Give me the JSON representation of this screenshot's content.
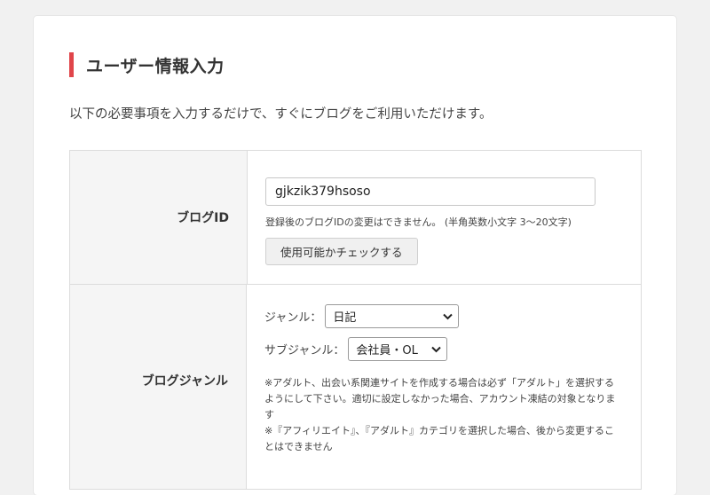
{
  "section": {
    "title": "ユーザー情報入力"
  },
  "intro": "以下の必要事項を入力するだけで、すぐにブログをご利用いただけます。",
  "blog_id": {
    "label": "ブログID",
    "value": "gjkzik379hsoso",
    "note": "登録後のブログIDの変更はできません。 (半角英数小文字 3〜20文字)",
    "check_button": "使用可能かチェックする"
  },
  "genre": {
    "label": "ブログジャンル",
    "genre_label": "ジャンル：",
    "genre_value": "日記",
    "subgenre_label": "サブジャンル：",
    "subgenre_value": "会社員・OL",
    "warning_1": "※アダルト、出会い系関連サイトを作成する場合は必ず「アダルト」を選択するようにして下さい。適切に設定しなかった場合、アカウント凍結の対象となります",
    "warning_2": "※『アフィリエイト』、『アダルト』カテゴリを選択した場合、後から変更することはできません"
  },
  "colors": {
    "accent": "#e0454a",
    "page_bg": "#f1f1f1",
    "label_bg": "#f5f5f5"
  },
  "icons": {
    "select_arrow": "chevron-down-icon"
  }
}
